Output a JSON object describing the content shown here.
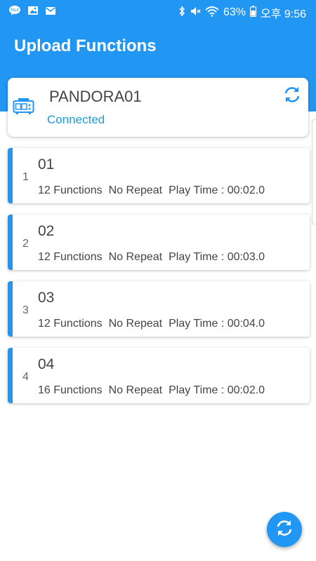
{
  "status_bar": {
    "battery": "63%",
    "time": "오후 9:56",
    "left_icons": [
      "chat-bubble-icon",
      "gallery-icon",
      "mail-icon"
    ],
    "right_icons": [
      "bluetooth-icon",
      "mute-icon",
      "wifi-icon",
      "battery-icon"
    ]
  },
  "app": {
    "title": "Upload Functions",
    "accent_color": "#2196F3"
  },
  "device": {
    "name": "PANDORA01",
    "status": "Connected",
    "status_color": "#1B9AD6",
    "icon": "device-panel-icon"
  },
  "items": [
    {
      "index": "1",
      "name": "01",
      "functions": "12 Functions",
      "repeat": "No Repeat",
      "play_time": "Play Time : 00:02.0"
    },
    {
      "index": "2",
      "name": "02",
      "functions": "12 Functions",
      "repeat": "No Repeat",
      "play_time": "Play Time : 00:03.0"
    },
    {
      "index": "3",
      "name": "03",
      "functions": "12 Functions",
      "repeat": "No Repeat",
      "play_time": "Play Time : 00:04.0"
    },
    {
      "index": "4",
      "name": "04",
      "functions": "16 Functions",
      "repeat": "No Repeat",
      "play_time": "Play Time : 00:02.0"
    }
  ],
  "fab": {
    "icon": "refresh-icon"
  }
}
